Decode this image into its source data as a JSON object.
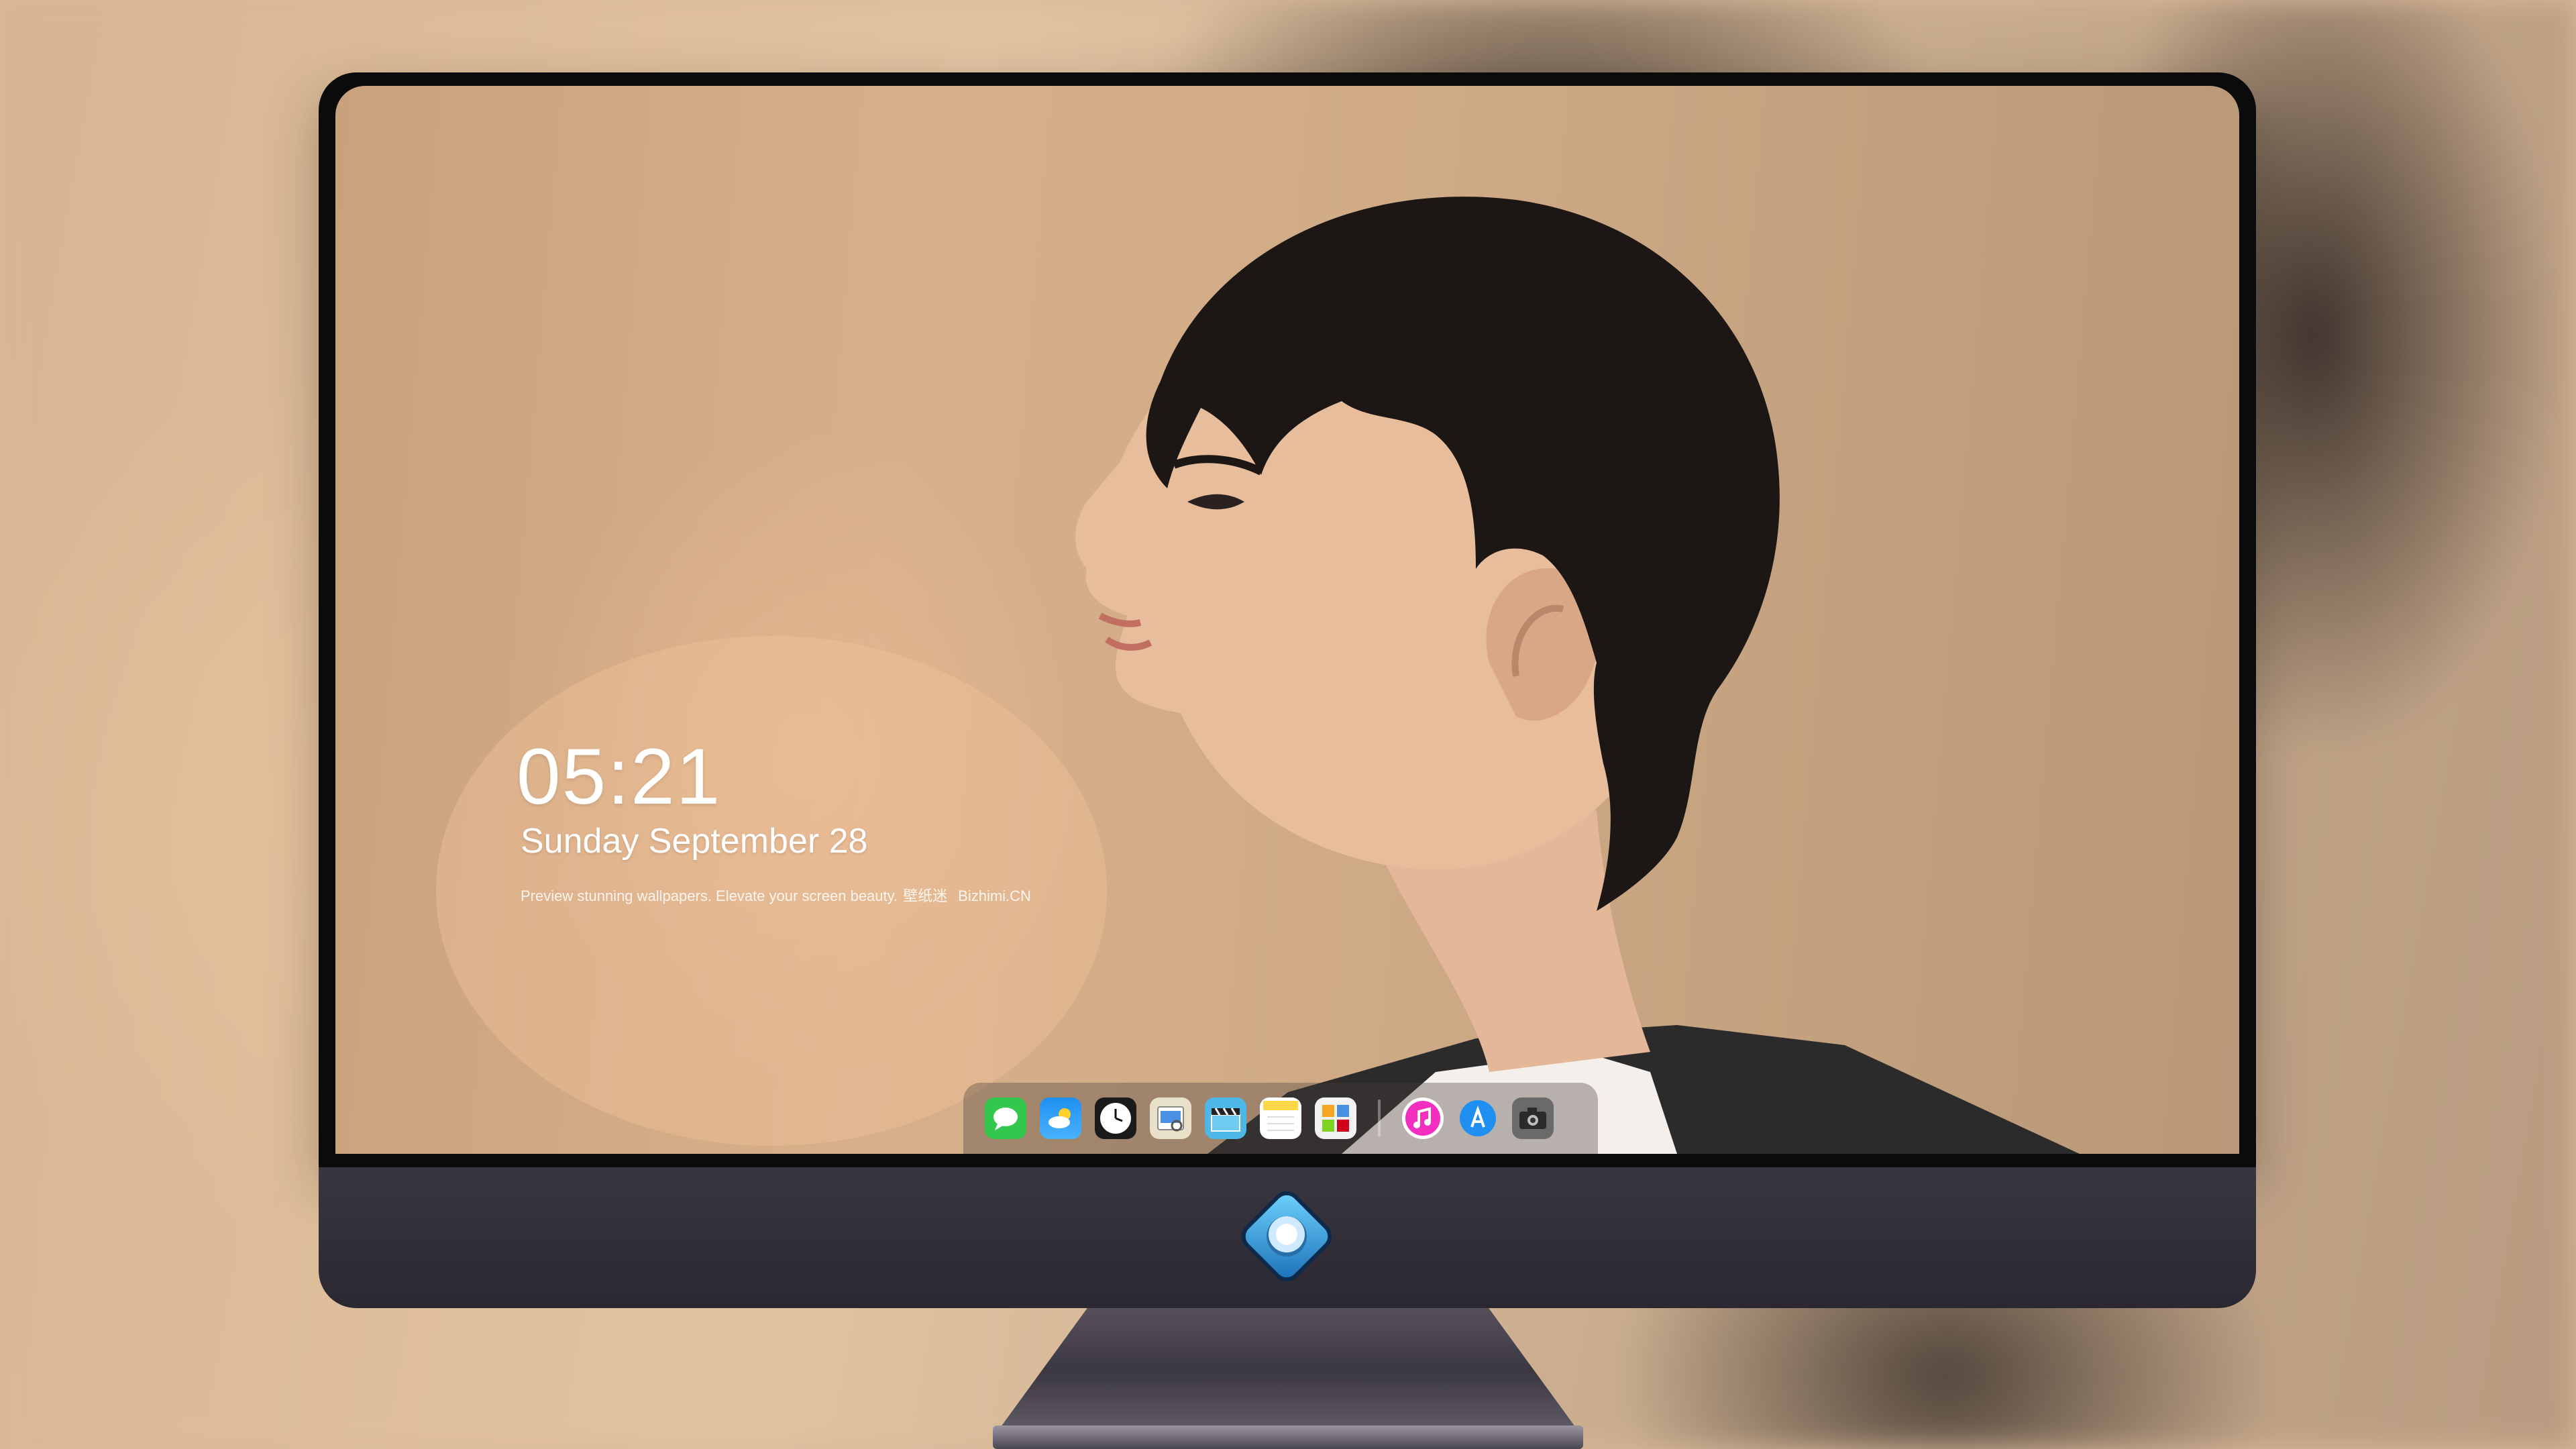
{
  "lockscreen": {
    "time": "05:21",
    "date": "Sunday September  28",
    "tagline": "Preview stunning wallpapers. Elevate your screen beauty.",
    "tagline_cjk": "壁纸迷",
    "site": "Bizhimi.CN"
  },
  "dock": {
    "apps": [
      {
        "name": "messages-icon",
        "color": "#33c74e"
      },
      {
        "name": "weather-icon",
        "color": "#1e8ff0"
      },
      {
        "name": "clock-icon",
        "color": "#1a1a1a"
      },
      {
        "name": "preview-icon",
        "color": "#e8e0c8"
      },
      {
        "name": "imovie-clapper-icon",
        "color": "#4db8e8"
      },
      {
        "name": "notes-icon",
        "color": "#ffd84a"
      },
      {
        "name": "photos-grid-icon",
        "color": "#f2f2f2"
      },
      {
        "name": "music-icon",
        "color": "#f22fbf"
      },
      {
        "name": "app-store-icon",
        "color": "#1f8ff2"
      },
      {
        "name": "camera-icon",
        "color": "#6a6a6a"
      }
    ]
  },
  "colors": {
    "screen_bg": "#cfaa86",
    "chin": "#332f38",
    "bezel": "#0b0b0c"
  }
}
